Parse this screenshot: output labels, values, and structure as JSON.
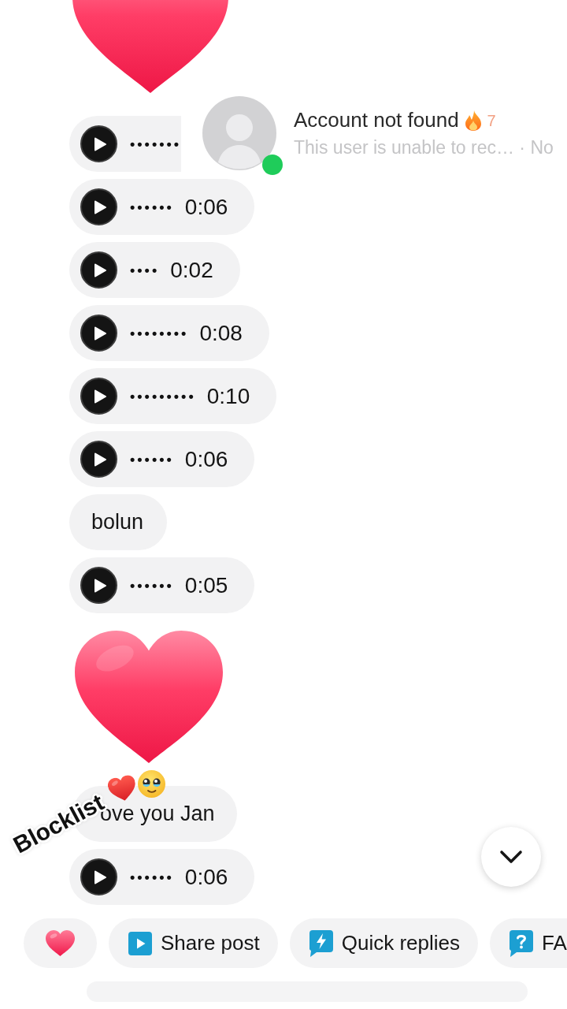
{
  "messages": [
    {
      "kind": "heart"
    },
    {
      "kind": "voice",
      "waveform": "•••••••"
    },
    {
      "kind": "voice",
      "waveform": "••••••",
      "duration": "0:06"
    },
    {
      "kind": "voice",
      "waveform": "••••",
      "duration": "0:02"
    },
    {
      "kind": "voice",
      "waveform": "••••••••",
      "duration": "0:08"
    },
    {
      "kind": "voice",
      "waveform": "•••••••••",
      "duration": "0:10"
    },
    {
      "kind": "voice",
      "waveform": "••••••",
      "duration": "0:06"
    },
    {
      "kind": "text",
      "text": "bolun"
    },
    {
      "kind": "voice",
      "waveform": "••••••",
      "duration": "0:05"
    },
    {
      "kind": "heart"
    },
    {
      "kind": "text",
      "text": "ove you Jan"
    },
    {
      "kind": "voice",
      "waveform": "••••••",
      "duration": "0:06"
    }
  ],
  "notification": {
    "title": "Account not found",
    "streak": "7",
    "subtitle": "This user is unable to rec… · No",
    "online": true
  },
  "sticker": {
    "text": "Blocklist"
  },
  "quick_actions": [
    {
      "kind": "heart"
    },
    {
      "kind": "share",
      "label": "Share post"
    },
    {
      "kind": "quick_replies",
      "label": "Quick replies"
    },
    {
      "kind": "faq",
      "label": "FA"
    }
  ]
}
